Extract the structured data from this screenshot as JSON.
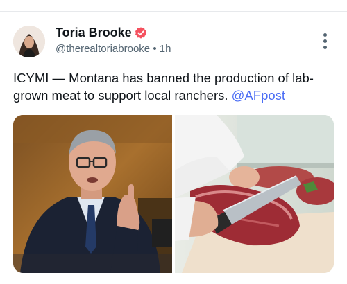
{
  "post": {
    "author_name": "Toria Brooke",
    "handle": "@therealtoriabrooke",
    "separator": "•",
    "time": "1h",
    "text_before": "ICYMI — Montana has banned the production of lab-grown meat to support local ranchers. ",
    "mention": "@AFpost"
  },
  "icons": {
    "verified": "verified-badge-icon",
    "more": "more-vertical-icon"
  },
  "colors": {
    "verified_badge": "#f5515f",
    "mention": "#4c6ef5",
    "secondary_text": "#536471"
  }
}
